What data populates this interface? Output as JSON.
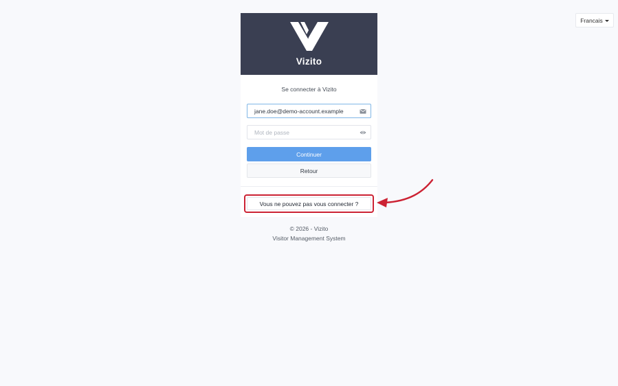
{
  "language": {
    "selected": "Francais",
    "icon": "caret-down-icon"
  },
  "brand": {
    "name": "Vizito",
    "logo_icon": "vizito-v-logo",
    "header_color": "#3a3f52"
  },
  "login": {
    "title": "Se connecter à Vizito",
    "email_value": "jane.doe@demo-account.example",
    "email_icon": "envelope-icon",
    "password_placeholder": "Mot de passe",
    "password_icon": "eye-icon",
    "continue_label": "Continuer",
    "continue_color": "#5e9feb",
    "back_label": "Retour",
    "cant_connect_label": "Vous ne pouvez pas vous connecter ?"
  },
  "annotation": {
    "highlight_color": "#cc2233",
    "arrow_icon": "curved-arrow-icon"
  },
  "footer": {
    "copyright": "© 2026 - Vizito",
    "tagline": "Visitor Management System"
  }
}
